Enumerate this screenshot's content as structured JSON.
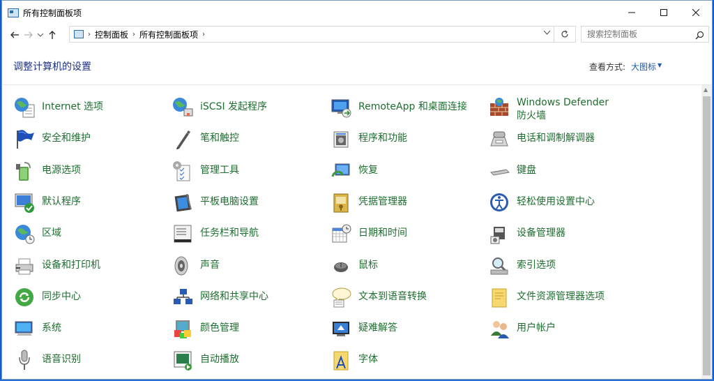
{
  "window": {
    "title": "所有控制面板项"
  },
  "address": {
    "crumbs": [
      "控制面板",
      "所有控制面板项"
    ]
  },
  "search": {
    "placeholder": "搜索控制面板"
  },
  "header": {
    "title": "调整计算机的设置",
    "view_label": "查看方式:",
    "view_value": "大图标"
  },
  "items": [
    {
      "label": "Internet 选项",
      "icon": "globe-icon"
    },
    {
      "label": "iSCSI 发起程序",
      "icon": "globe-network-icon"
    },
    {
      "label": "RemoteApp 和桌面连接",
      "icon": "remote-desktop-icon"
    },
    {
      "label": "Windows Defender 防火墙",
      "icon": "firewall-icon"
    },
    {
      "label": "安全和维护",
      "icon": "flag-icon"
    },
    {
      "label": "笔和触控",
      "icon": "pen-icon"
    },
    {
      "label": "程序和功能",
      "icon": "programs-icon"
    },
    {
      "label": "电话和调制解调器",
      "icon": "phone-icon"
    },
    {
      "label": "电源选项",
      "icon": "power-icon"
    },
    {
      "label": "管理工具",
      "icon": "admin-tools-icon"
    },
    {
      "label": "恢复",
      "icon": "recovery-icon"
    },
    {
      "label": "键盘",
      "icon": "keyboard-icon"
    },
    {
      "label": "默认程序",
      "icon": "default-programs-icon"
    },
    {
      "label": "平板电脑设置",
      "icon": "tablet-icon"
    },
    {
      "label": "凭据管理器",
      "icon": "credential-icon"
    },
    {
      "label": "轻松使用设置中心",
      "icon": "ease-of-access-icon"
    },
    {
      "label": "区域",
      "icon": "region-icon"
    },
    {
      "label": "任务栏和导航",
      "icon": "taskbar-icon"
    },
    {
      "label": "日期和时间",
      "icon": "calendar-clock-icon"
    },
    {
      "label": "设备管理器",
      "icon": "device-manager-icon"
    },
    {
      "label": "设备和打印机",
      "icon": "printer-icon"
    },
    {
      "label": "声音",
      "icon": "speaker-icon"
    },
    {
      "label": "鼠标",
      "icon": "mouse-icon"
    },
    {
      "label": "索引选项",
      "icon": "indexing-icon"
    },
    {
      "label": "同步中心",
      "icon": "sync-icon"
    },
    {
      "label": "网络和共享中心",
      "icon": "network-icon"
    },
    {
      "label": "文本到语音转换",
      "icon": "text-speech-icon"
    },
    {
      "label": "文件资源管理器选项",
      "icon": "folder-options-icon"
    },
    {
      "label": "系统",
      "icon": "system-icon"
    },
    {
      "label": "颜色管理",
      "icon": "color-management-icon"
    },
    {
      "label": "疑难解答",
      "icon": "troubleshoot-icon"
    },
    {
      "label": "用户帐户",
      "icon": "user-accounts-icon"
    },
    {
      "label": "语音识别",
      "icon": "microphone-icon"
    },
    {
      "label": "自动播放",
      "icon": "autoplay-icon"
    },
    {
      "label": "字体",
      "icon": "fonts-icon"
    }
  ]
}
